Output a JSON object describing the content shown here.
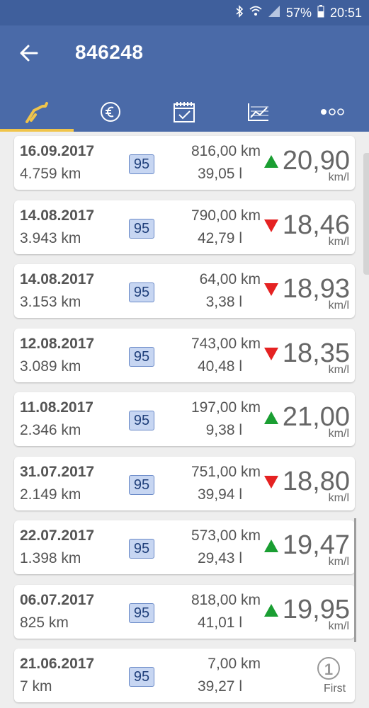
{
  "status": {
    "battery": "57%",
    "time": "20:51"
  },
  "header": {
    "title": "846248"
  },
  "tabs": [
    {
      "icon": "fuel-pump-icon"
    },
    {
      "icon": "euro-icon"
    },
    {
      "icon": "calendar-check-icon"
    },
    {
      "icon": "chart-icon"
    },
    {
      "icon": "more-icon"
    }
  ],
  "colors": {
    "up": "#1a9e32",
    "down": "#e52222"
  },
  "entries": [
    {
      "date": "16.09.2017",
      "odo": "4.759 km",
      "fuel": "95",
      "distance": "816,00 km",
      "liters": "39,05 l",
      "trend": "up",
      "consumption": "20,90",
      "unit": "km/l"
    },
    {
      "date": "14.08.2017",
      "odo": "3.943 km",
      "fuel": "95",
      "distance": "790,00 km",
      "liters": "42,79 l",
      "trend": "down",
      "consumption": "18,46",
      "unit": "km/l"
    },
    {
      "date": "14.08.2017",
      "odo": "3.153 km",
      "fuel": "95",
      "distance": "64,00 km",
      "liters": "3,38 l",
      "trend": "down",
      "consumption": "18,93",
      "unit": "km/l"
    },
    {
      "date": "12.08.2017",
      "odo": "3.089 km",
      "fuel": "95",
      "distance": "743,00 km",
      "liters": "40,48 l",
      "trend": "down",
      "consumption": "18,35",
      "unit": "km/l"
    },
    {
      "date": "11.08.2017",
      "odo": "2.346 km",
      "fuel": "95",
      "distance": "197,00 km",
      "liters": "9,38 l",
      "trend": "up",
      "consumption": "21,00",
      "unit": "km/l"
    },
    {
      "date": "31.07.2017",
      "odo": "2.149 km",
      "fuel": "95",
      "distance": "751,00 km",
      "liters": "39,94 l",
      "trend": "down",
      "consumption": "18,80",
      "unit": "km/l"
    },
    {
      "date": "22.07.2017",
      "odo": "1.398 km",
      "fuel": "95",
      "distance": "573,00 km",
      "liters": "29,43 l",
      "trend": "up",
      "consumption": "19,47",
      "unit": "km/l"
    },
    {
      "date": "06.07.2017",
      "odo": "825 km",
      "fuel": "95",
      "distance": "818,00 km",
      "liters": "41,01 l",
      "trend": "up",
      "consumption": "19,95",
      "unit": "km/l"
    },
    {
      "date": "21.06.2017",
      "odo": "7 km",
      "fuel": "95",
      "distance": "7,00 km",
      "liters": "39,27 l",
      "first_number": "1",
      "first_label": "First"
    }
  ]
}
